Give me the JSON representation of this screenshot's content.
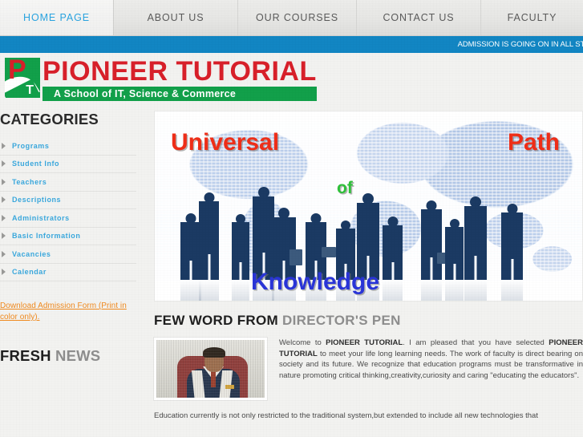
{
  "nav": {
    "items": [
      {
        "label": "HOME PAGE",
        "active": true
      },
      {
        "label": "ABOUT US",
        "active": false
      },
      {
        "label": "OUR COURSES",
        "active": false
      },
      {
        "label": "CONTACT US",
        "active": false
      },
      {
        "label": "FACULTY",
        "active": false
      }
    ],
    "active_color": "#2aa4e0",
    "inactive_color": "#5a5a5a",
    "background": "#e8e8e6"
  },
  "marquee": {
    "text": "ADMISSION IS GOING ON IN ALL STR",
    "background": "#1286c3",
    "color": "#ffffff"
  },
  "logo": {
    "mark_letter_p": "P",
    "mark_letter_t": "T",
    "title": "PIONEER TUTORIAL",
    "subtitle": "A School of IT, Science & Commerce",
    "title_color": "#d8202a",
    "subtitle_background": "#12a04a",
    "subtitle_color": "#ffffff"
  },
  "sidebar": {
    "categories_heading": "CATEGORIES",
    "items": [
      {
        "label": "Programs"
      },
      {
        "label": "Student Info"
      },
      {
        "label": "Teachers"
      },
      {
        "label": "Descriptions"
      },
      {
        "label": "Administrators"
      },
      {
        "label": "Basic Information"
      },
      {
        "label": "Vacancies"
      },
      {
        "label": "Calendar"
      }
    ],
    "item_color": "#3aa8dd",
    "download_link": "Download Admission Form (Print in color only).",
    "download_link_color": "#f08a1e",
    "news_heading_strong": "FRESH",
    "news_heading_light": "NEWS"
  },
  "banner": {
    "word_universal": "Universal",
    "word_path": "Path",
    "word_of": "of",
    "word_knowledge": "Knowledge",
    "color_universal": "#ef2e18",
    "color_path": "#ef2e18",
    "color_of": "#2fc13a",
    "color_knowledge": "#2a35d8",
    "alt": "Business people silhouettes over a world map"
  },
  "director": {
    "heading_strong": "FEW WORD FROM",
    "heading_light": "DIRECTOR'S PEN",
    "photo_alt": "Photograph of the director",
    "paragraph_1_part_1": "Welcome to ",
    "paragraph_1_bold_1": "PIONEER TUTORIAL",
    "paragraph_1_part_2": ". I am pleased that you have selected ",
    "paragraph_1_bold_2": "PIONEER TUTORIAL",
    "paragraph_1_part_3": " to meet your life long learning needs. The work of faculty is direct bearing on society and its future. We recognize that education programs must be transformative in nature promoting critical thinking,creativity,curiosity and caring \"educating the educators\".",
    "paragraph_2": "Education currently is not only restricted to the traditional system,but extended to include all new technologies that"
  }
}
